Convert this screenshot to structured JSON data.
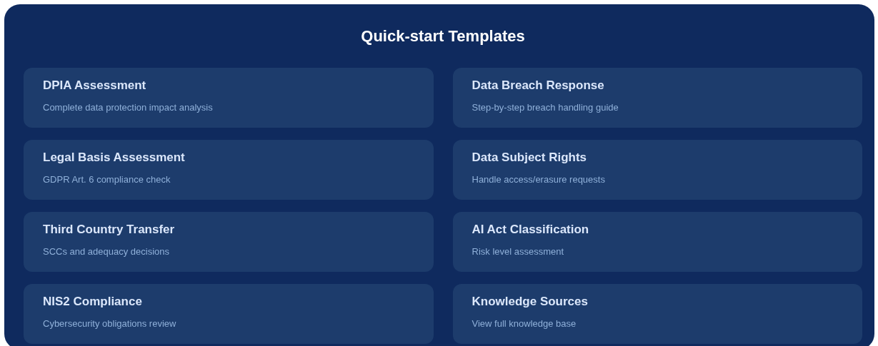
{
  "panel": {
    "title": "Quick-start Templates"
  },
  "templates": [
    {
      "title": "DPIA Assessment",
      "description": "Complete data protection impact analysis"
    },
    {
      "title": "Data Breach Response",
      "description": "Step-by-step breach handling guide"
    },
    {
      "title": "Legal Basis Assessment",
      "description": "GDPR Art. 6 compliance check"
    },
    {
      "title": "Data Subject Rights",
      "description": "Handle access/erasure requests"
    },
    {
      "title": "Third Country Transfer",
      "description": "SCCs and adequacy decisions"
    },
    {
      "title": "AI Act Classification",
      "description": "Risk level assessment"
    },
    {
      "title": "NIS2 Compliance",
      "description": "Cybersecurity obligations review"
    },
    {
      "title": "Knowledge Sources",
      "description": "View full knowledge base"
    }
  ]
}
